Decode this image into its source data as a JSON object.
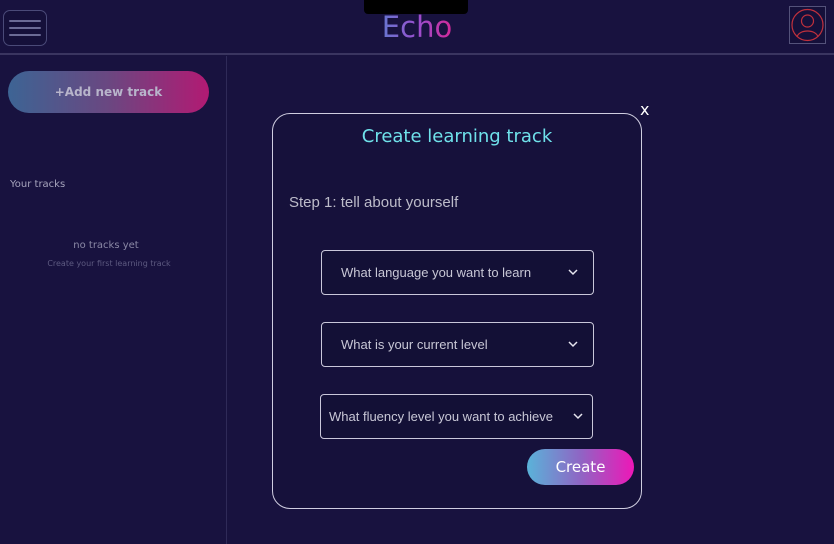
{
  "header": {
    "logo": "Echo"
  },
  "sidebar": {
    "add_track_label": "+Add new track",
    "your_tracks_label": "Your tracks",
    "empty_title": "no tracks yet",
    "empty_subtitle": "Create your first learning track"
  },
  "modal": {
    "close_label": "x",
    "title": "Create learning track",
    "step_label": "Step 1: tell about yourself",
    "selects": [
      {
        "placeholder": "What language you want to learn"
      },
      {
        "placeholder": "What is your current level"
      },
      {
        "placeholder": "What fluency level you want to achieve"
      }
    ],
    "create_label": "Create"
  },
  "colors": {
    "background": "#18123f",
    "title_accent": "#6fe1ea",
    "gradient_start": "#5ab3d9",
    "gradient_end": "#ee17b7"
  },
  "icons": {
    "menu": "hamburger-menu-icon",
    "avatar": "user-avatar-icon",
    "dropdown": "chevron-down-icon"
  }
}
